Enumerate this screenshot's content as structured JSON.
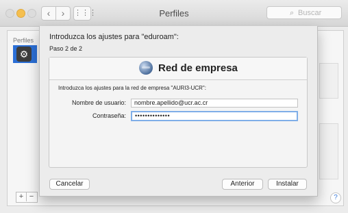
{
  "window": {
    "title": "Perfiles",
    "search_placeholder": "Buscar",
    "nav_back": "‹",
    "nav_forward": "›",
    "grid": "⋮⋮⋮"
  },
  "sidebar": {
    "header": "Perfiles"
  },
  "footer": {
    "add": "+",
    "remove": "−",
    "help": "?"
  },
  "sheet": {
    "title": "Introduzca los ajustes para \"eduroam\":",
    "step": "Paso 2 de 2",
    "panel_heading": "Red de empresa",
    "panel_description": "Introduzca los ajustes para la red de empresa \"AURI3-UCR\":",
    "username_label": "Nombre de usuario:",
    "username_value": "nombre.apellido@ucr.ac.cr",
    "password_label": "Contraseña:",
    "password_value": "••••••••••••••",
    "cancel_label": "Cancelar",
    "previous_label": "Anterior",
    "install_label": "Instalar"
  },
  "icons": {
    "search": "search-icon",
    "globe": "globe-icon",
    "profile": "profile-icon"
  }
}
